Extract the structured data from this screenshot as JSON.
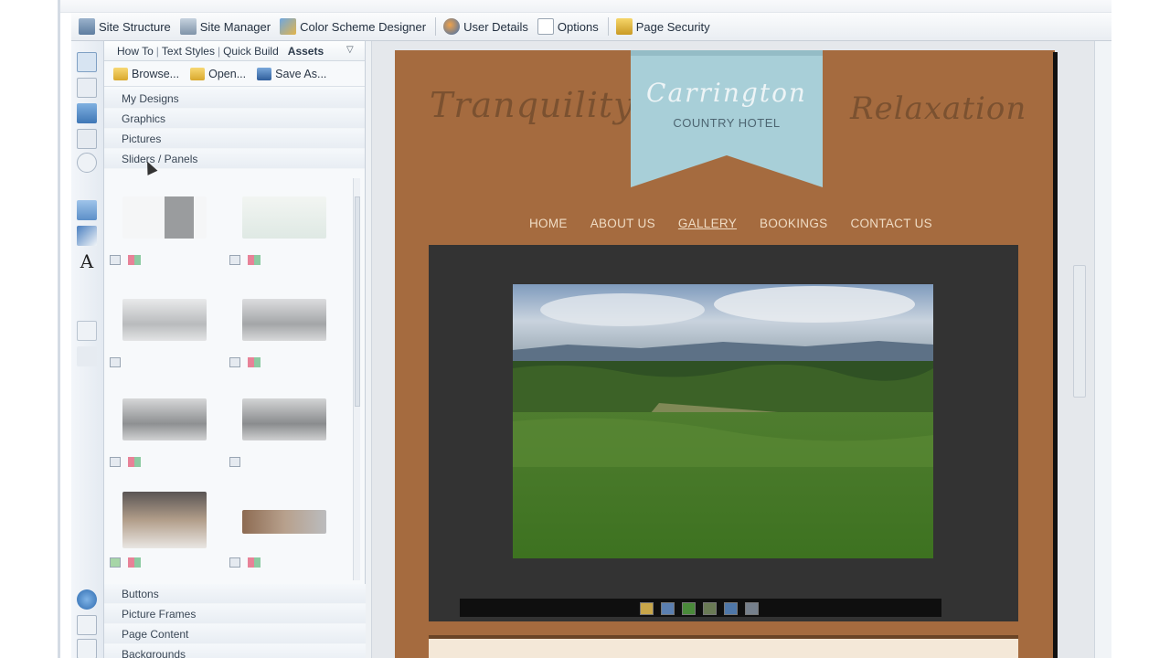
{
  "toolbar": {
    "items": [
      {
        "label": "Site Structure",
        "icon": "site-structure-icon"
      },
      {
        "label": "Site Manager",
        "icon": "site-manager-icon"
      },
      {
        "label": "Color Scheme Designer",
        "icon": "paint-brush-icon"
      },
      {
        "label": "User Details",
        "icon": "users-icon"
      },
      {
        "label": "Options",
        "icon": "options-icon"
      },
      {
        "label": "Page Security",
        "icon": "lock-icon"
      }
    ]
  },
  "panel": {
    "tabs": [
      "How To",
      "Text Styles",
      "Quick Build"
    ],
    "active_tab": "Assets",
    "actions": {
      "browse": "Browse...",
      "open": "Open...",
      "save_as": "Save As..."
    },
    "categories_top": [
      "My Designs",
      "Graphics",
      "Pictures",
      "Sliders / Panels"
    ],
    "categories_bottom": [
      "Buttons",
      "Picture Frames",
      "Page Content",
      "Backgrounds"
    ]
  },
  "site": {
    "tagline_left": "Tranquility",
    "tagline_right": "Relaxation",
    "brand_title": "Carrington",
    "brand_subtitle": "COUNTRY HOTEL",
    "nav": [
      "HOME",
      "ABOUT US",
      "GALLERY",
      "BOOKINGS",
      "CONTACT US"
    ],
    "active_nav": "GALLERY"
  },
  "colors": {
    "page_bg": "#a56b3f",
    "banner": "#a8cfd8",
    "gallery_bg": "#333333",
    "nav_text": "#f0dcc4"
  }
}
